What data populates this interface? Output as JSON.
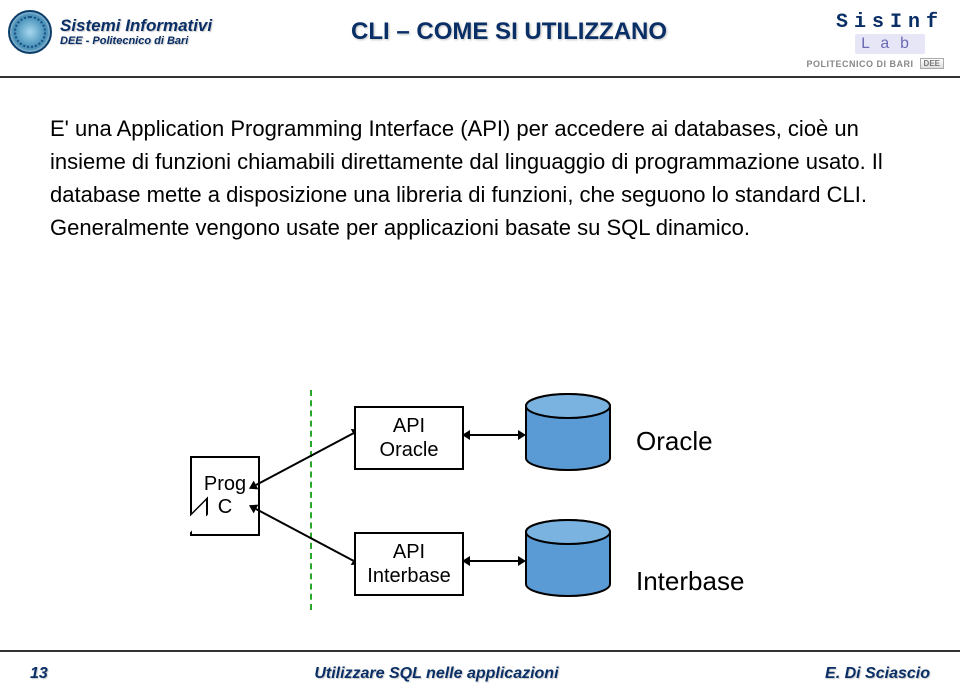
{
  "header": {
    "org_title": "Sistemi Informativi",
    "org_sub": "DEE - Politecnico di Bari",
    "slide_title": "CLI – COME SI UTILIZZANO",
    "brand_top": "SisInf",
    "brand_bottom": "Lab",
    "brand_sub": "POLITECNICO DI BARI",
    "brand_dee": "DEE"
  },
  "body_text": "E' una Application Programming Interface (API) per accedere ai databases, cioè un insieme di funzioni chiamabili direttamente dal linguaggio di programmazione usato. Il database mette a disposizione una libreria di funzioni, che seguono lo standard CLI. Generalmente vengono usate per applicazioni basate su SQL dinamico.",
  "diagram": {
    "prog_line1": "Prog",
    "prog_line2": "C",
    "api1_line1": "API",
    "api1_line2": "Oracle",
    "api2_line1": "API",
    "api2_line2": "Interbase",
    "db1_label": "Oracle",
    "db2_label": "Interbase",
    "cylinder_fill": "#5b9bd5"
  },
  "footer": {
    "page_num": "13",
    "center": "Utilizzare SQL nelle applicazioni",
    "author": "E. Di Sciascio"
  }
}
